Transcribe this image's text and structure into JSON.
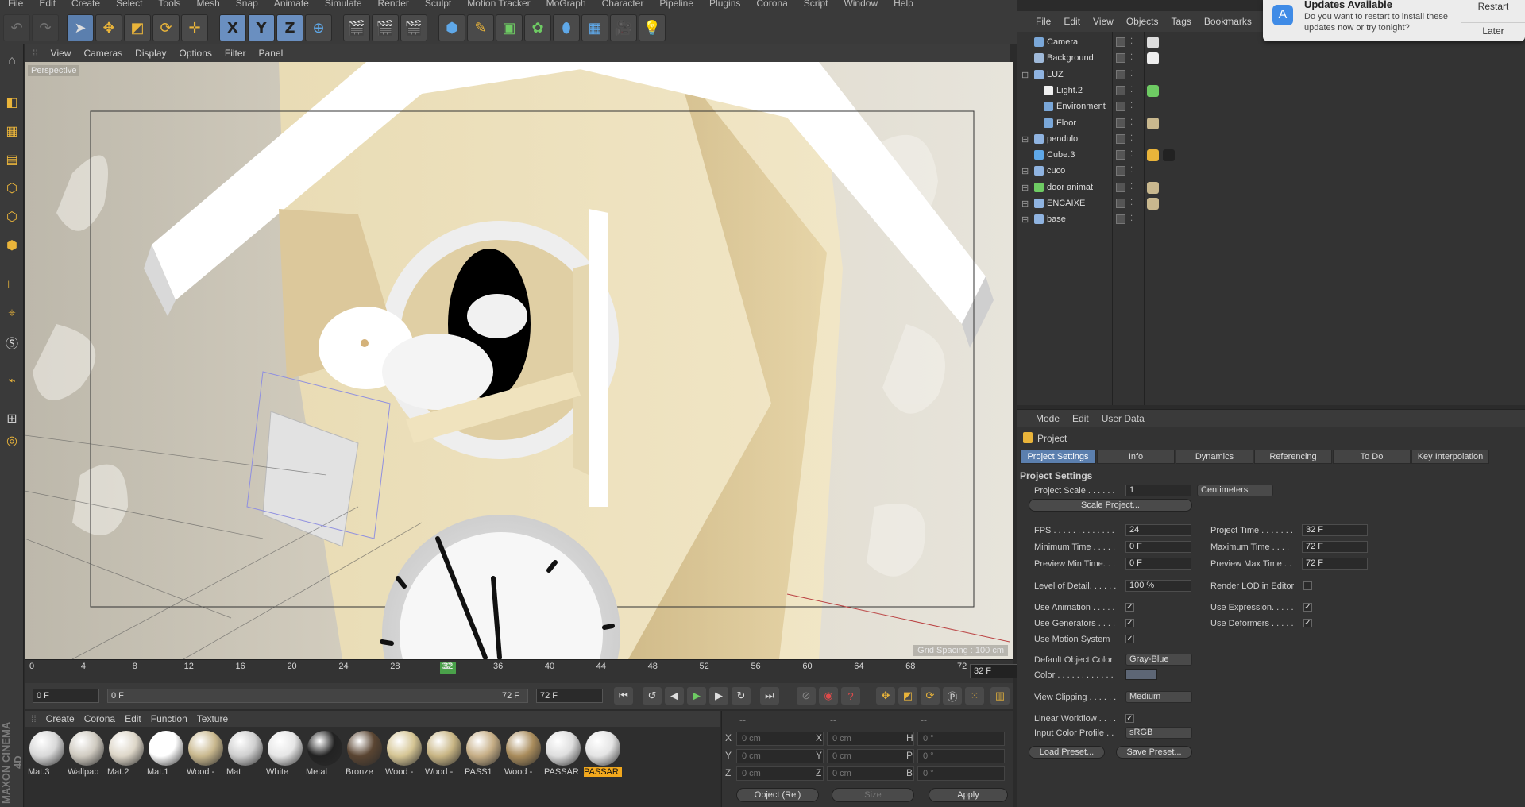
{
  "menubar": [
    "File",
    "Edit",
    "Create",
    "Select",
    "Tools",
    "Mesh",
    "Snap",
    "Animate",
    "Simulate",
    "Render",
    "Sculpt",
    "Motion Tracker",
    "MoGraph",
    "Character",
    "Pipeline",
    "Plugins",
    "Corona",
    "Script",
    "Window",
    "Help"
  ],
  "toolbar": {
    "axis_x": "X",
    "axis_y": "Y",
    "axis_z": "Z"
  },
  "viewport": {
    "menu": [
      "View",
      "Cameras",
      "Display",
      "Options",
      "Filter",
      "Panel"
    ],
    "label": "Perspective",
    "grid_spacing": "Grid Spacing : 100 cm"
  },
  "timeline": {
    "ticks": [
      "0",
      "4",
      "8",
      "12",
      "16",
      "20",
      "24",
      "28",
      "32",
      "36",
      "40",
      "44",
      "48",
      "52",
      "56",
      "60",
      "64",
      "68",
      "72"
    ],
    "current": "32",
    "frame_box": "32 F",
    "start_field": "0 F",
    "range_start": "0 F",
    "range_end": "72 F",
    "end_field": "72 F"
  },
  "materials": {
    "menu": [
      "Create",
      "Corona",
      "Edit",
      "Function",
      "Texture"
    ],
    "items": [
      {
        "name": "Mat.3",
        "color": "#d8d8d8"
      },
      {
        "name": "Wallpap",
        "color": "#cfcac0"
      },
      {
        "name": "Mat.2",
        "color": "#ddd6c8"
      },
      {
        "name": "Mat.1",
        "color": "#ffffff"
      },
      {
        "name": "Wood -",
        "color": "#c9b88e"
      },
      {
        "name": "Mat",
        "color": "#cfcfcf"
      },
      {
        "name": "White",
        "color": "#e6e6e6"
      },
      {
        "name": "Metal",
        "color": "#222222"
      },
      {
        "name": "Bronze",
        "color": "#5a4532"
      },
      {
        "name": "Wood -",
        "color": "#d5c594"
      },
      {
        "name": "Wood -",
        "color": "#c8b584"
      },
      {
        "name": "PASS1",
        "color": "#c6ae86"
      },
      {
        "name": "Wood -",
        "color": "#a98c5c"
      },
      {
        "name": "PASSAR",
        "color": "#dedede"
      },
      {
        "name": "PASSAR",
        "color": "#e4e4e4"
      }
    ]
  },
  "coords": {
    "headers": [
      "--",
      "--",
      "--"
    ],
    "rows": [
      {
        "a": "X",
        "av": "0 cm",
        "b": "X",
        "bv": "0 cm",
        "c": "H",
        "cv": "0 °"
      },
      {
        "a": "Y",
        "av": "0 cm",
        "b": "Y",
        "bv": "0 cm",
        "c": "P",
        "cv": "0 °"
      },
      {
        "a": "Z",
        "av": "0 cm",
        "b": "Z",
        "bv": "0 cm",
        "c": "B",
        "cv": "0 °"
      }
    ],
    "mode": "Object (Rel)",
    "size": "Size",
    "apply": "Apply"
  },
  "objects": {
    "menu": [
      "File",
      "Edit",
      "View",
      "Objects",
      "Tags",
      "Bookmarks"
    ],
    "items": [
      {
        "name": "Camera",
        "indent": 0,
        "icon": "#7aa7d8"
      },
      {
        "name": "Background",
        "indent": 0,
        "icon": "#9fb9d9"
      },
      {
        "name": "LUZ",
        "indent": 0,
        "icon": "#8fb3e0"
      },
      {
        "name": "Light.2",
        "indent": 1,
        "icon": "#f0f0f0"
      },
      {
        "name": "Environment",
        "indent": 1,
        "icon": "#7aa7d8"
      },
      {
        "name": "Floor",
        "indent": 1,
        "icon": "#7aa7d8"
      },
      {
        "name": "pendulo",
        "indent": 0,
        "icon": "#8fb3e0"
      },
      {
        "name": "Cube.3",
        "indent": 0,
        "icon": "#5fa8e8"
      },
      {
        "name": "cuco",
        "indent": 0,
        "icon": "#8fb3e0"
      },
      {
        "name": "door animat",
        "indent": 0,
        "icon": "#6ecb63"
      },
      {
        "name": "ENCAIXE",
        "indent": 0,
        "icon": "#8fb3e0"
      },
      {
        "name": "base",
        "indent": 0,
        "icon": "#8fb3e0"
      }
    ]
  },
  "notification": {
    "title": "Updates Available",
    "body": "Do you want to restart to install these updates now or try tonight?",
    "restart": "Restart",
    "later": "Later"
  },
  "attributes": {
    "menu": [
      "Mode",
      "Edit",
      "User Data"
    ],
    "object": "Project",
    "tabs": [
      "Project Settings",
      "Info",
      "Dynamics",
      "Referencing",
      "To Do",
      "Key Interpolation"
    ],
    "section": "Project Settings",
    "project_scale_label": "Project Scale . . . . . .",
    "project_scale": "1",
    "units": "Centimeters",
    "scale_project": "Scale Project...",
    "fps_label": "FPS . . . . . . . . . . . . .",
    "fps": "24",
    "project_time_label": "Project Time . . . . . . .",
    "project_time": "32 F",
    "min_time_label": "Minimum Time . . . . .",
    "min_time": "0 F",
    "max_time_label": "Maximum Time . . . .",
    "max_time": "72 F",
    "prev_min_label": "Preview Min Time. . .",
    "prev_min": "0 F",
    "prev_max_label": "Preview Max Time . .",
    "prev_max": "72 F",
    "lod_label": "Level of Detail. . . . . .",
    "lod": "100 %",
    "render_lod_label": "Render LOD in Editor",
    "use_anim_label": "Use Animation . . . . .",
    "use_expr_label": "Use Expression. . . . .",
    "use_gen_label": "Use Generators . . . .",
    "use_def_label": "Use Deformers . . . . .",
    "use_motion_label": "Use Motion System",
    "def_color_label": "Default Object Color",
    "def_color": "Gray-Blue",
    "color_label": "Color . . . . . . . . . . . .",
    "swatch": "#5d6675",
    "clipping_label": "View Clipping . . . . . .",
    "clipping": "Medium",
    "linear_label": "Linear Workflow . . . .",
    "icp_label": "Input Color Profile . .",
    "icp": "sRGB",
    "load_preset": "Load Preset...",
    "save_preset": "Save Preset..."
  },
  "brand": "MAXON CINEMA 4D"
}
